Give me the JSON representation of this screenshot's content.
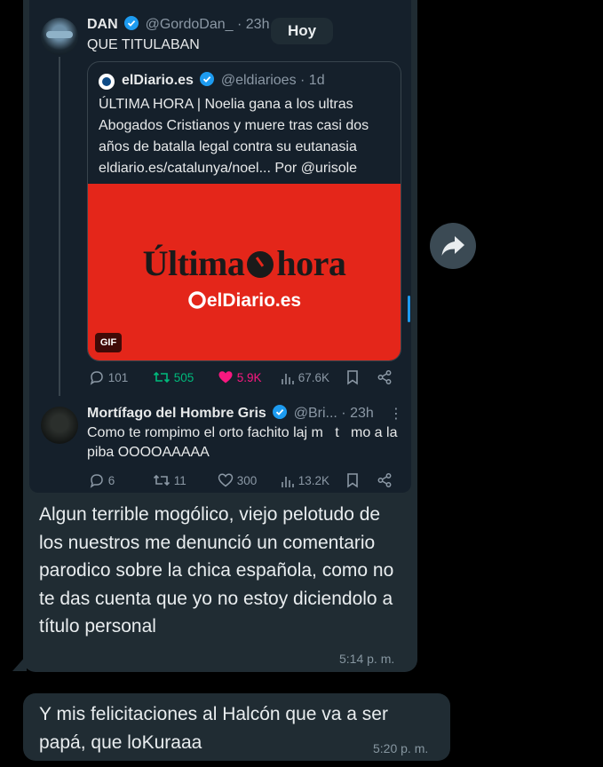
{
  "date_chip": "Hoy",
  "tweet": {
    "author_name": "DAN",
    "author_handle": "@GordoDan_",
    "age": "· 23h",
    "text": "QUE TITULABAN",
    "quote": {
      "author_name": "elDiario.es",
      "author_handle": "@eldiarioes",
      "age": "· 1d",
      "text": "ÚLTIMA HORA | Noelia gana a los ultras Abogados Cristianos y muere tras casi dos años de batalla legal contra su eutanasia eldiario.es/catalunya/noel... Por @urisole",
      "media_title_left": "Última",
      "media_title_right": "hora",
      "media_logo": "elDiario.es",
      "gif_label": "GIF"
    },
    "stats": {
      "replies": "101",
      "reposts": "505",
      "likes": "5.9K",
      "views": "67.6K"
    }
  },
  "reply": {
    "author_name": "Mortífago del Hombre Gris",
    "author_handle": "@Bri...",
    "age": "· 23h",
    "text": "Como te rompimo el orto fachito laj m   t   mo a la piba OOOOAAAAA",
    "stats": {
      "replies": "6",
      "reposts": "11",
      "likes": "300",
      "views": "13.2K"
    }
  },
  "messages": [
    {
      "text": "Algun terrible mogólico, viejo pelotudo de los nuestros me denunció un comentario parodico sobre la chica española, como no te das cuenta que yo no estoy diciendolo a título personal",
      "time": "5:14 p. m."
    },
    {
      "text": "Y mis felicitaciones al Halcón que va a ser papá, que loKuraaa",
      "time": "5:20 p. m."
    }
  ],
  "colors": {
    "background": "#000000",
    "bubble": "#202c33",
    "tweet_bg": "#15202b",
    "verified": "#1d9bf0",
    "repost_green": "#00ba7c",
    "like_pink": "#f91880",
    "media_red": "#e4261a"
  },
  "icons": [
    "verified-badge-icon",
    "reply-icon",
    "repost-icon",
    "heart-icon",
    "views-icon",
    "bookmark-icon",
    "share-icon",
    "more-icon",
    "forward-icon"
  ]
}
